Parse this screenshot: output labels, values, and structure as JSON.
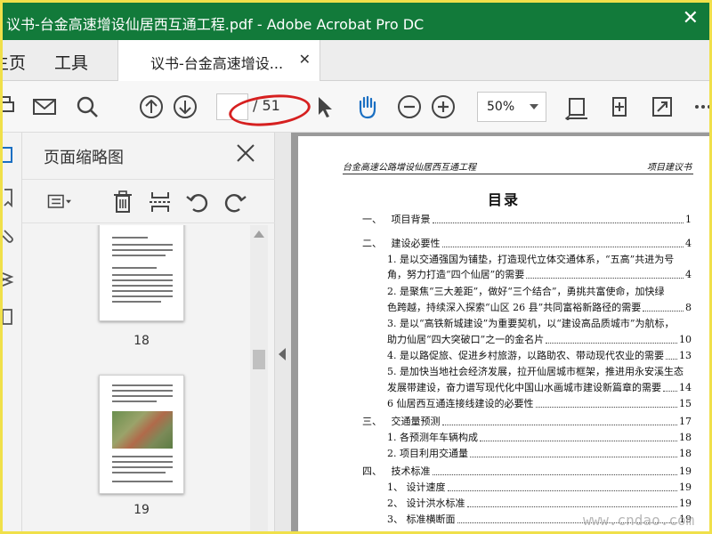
{
  "window": {
    "title": "议书-台金高速增设仙居西互通工程.pdf - Adobe Acrobat Pro DC",
    "close_glyph": "✕"
  },
  "menu": {
    "home": "主页",
    "tools": "工具"
  },
  "tab": {
    "label": "议书-台金高速增设...",
    "close_glyph": "✕"
  },
  "toolbar": {
    "page_current": "",
    "page_total": "/ 51",
    "zoom": "50%",
    "icons": [
      "print-icon",
      "email-icon",
      "search-icon",
      "prev-page-icon",
      "next-page-icon",
      "select-cursor-icon",
      "hand-tool-icon",
      "zoom-out-icon",
      "zoom-in-icon",
      "fit-page-icon",
      "rotate-icon",
      "fullscreen-icon",
      "more-icon"
    ]
  },
  "panel": {
    "title": "页面缩略图",
    "close_glyph": "✕",
    "thumbnails": [
      {
        "page": "18"
      },
      {
        "page": "19"
      }
    ]
  },
  "document": {
    "header_left": "台金高速公路增设仙居西互通工程",
    "header_right": "项目建议书",
    "toc_title": "目录",
    "toc": [
      {
        "num": "一、",
        "text": "项目背景",
        "page": "1"
      },
      {
        "num": "二、",
        "text": "建设必要性",
        "page": "4"
      },
      {
        "num": "1.",
        "text": "是以交通强国为铺垫，打造现代立体交通体系，“五高”共进为号",
        "cont": "角，努力打造“四个仙居”的需要",
        "page": "4"
      },
      {
        "num": "2.",
        "text": "是聚焦“三大差距”，做好“三个结合”，勇挑共富使命，加快绿",
        "cont": "色跨越，持续深入探索“山区 26 县”共同富裕新路径的需要",
        "page": "8"
      },
      {
        "num": "3.",
        "text": "是以“高铁新城建设”为重要契机，以“建设高品质城市”为航标，",
        "cont": "助力仙居“四大突破口”之一的金名片",
        "page": "10"
      },
      {
        "num": "4.",
        "text": "是以路促旅、促进乡村旅游，以路助农、带动现代农业的需要",
        "page": "13"
      },
      {
        "num": "5.",
        "text": "是加快当地社会经济发展，拉开仙居城市框架，推进用永安溪生态",
        "cont": "发展带建设，奋力谱写现代化中国山水画城市建设新篇章的需要",
        "page": "14"
      },
      {
        "num": "6",
        "text": "仙居西互通连接线建设的必要性",
        "page": "15"
      },
      {
        "num": "三、",
        "text": "交通量预测",
        "page": "17"
      },
      {
        "num": "1.",
        "text": "各预测年车辆构成",
        "page": "18"
      },
      {
        "num": "2.",
        "text": "项目利用交通量",
        "page": "18"
      },
      {
        "num": "四、",
        "text": "技术标准",
        "page": "19"
      },
      {
        "num": "1、",
        "text": "设计速度",
        "page": "19"
      },
      {
        "num": "2、",
        "text": "设计洪水标准",
        "page": "19"
      },
      {
        "num": "3、",
        "text": "标准横断面",
        "page": "19"
      }
    ]
  },
  "watermarks": {
    "bottom": "www.cndao.com"
  },
  "colors": {
    "titlebar": "#127a3a",
    "annotation": "#d62020",
    "outer_border": "#f0e04a"
  }
}
